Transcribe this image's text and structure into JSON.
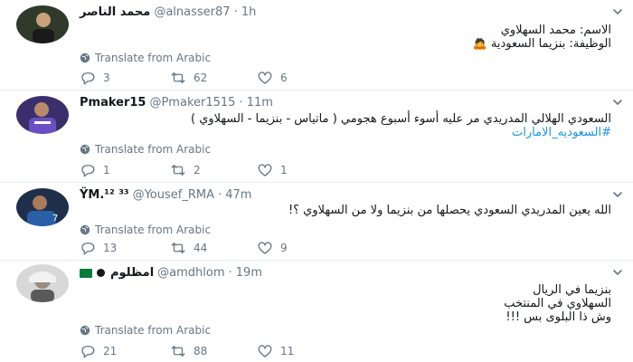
{
  "translate_label": "Translate from Arabic",
  "colors": {
    "accent": "#1b95e0",
    "muted": "#657786",
    "divider": "#e6ecf0"
  },
  "tweets": [
    {
      "name": "محمد الناصر",
      "handle": "@alnasser87",
      "time": "· 1h",
      "lines": [
        "الاسم: محمد السهلاوي",
        "الوظيفة: بنزيما السعودية 🙇"
      ],
      "replies": "3",
      "retweets": "62",
      "likes": "6"
    },
    {
      "name": "Pmaker15",
      "handle": "@Pmaker1515",
      "time": "· 11m",
      "lines": [
        "السعودي الهلالي المدريدي مر عليه أسوء أسبوع هجومي ( ماتياس - بنزيما - السهلاوي )"
      ],
      "hashtag": "#السعوديه_الامارات",
      "replies": "1",
      "retweets": "2",
      "likes": "1"
    },
    {
      "name": "ŸM.¹² ³³",
      "handle": "@Yousef_RMA",
      "time": "· 47m",
      "lines": [
        "الله يعين المدريدي السعودي يحصلها من بنزيما ولا من السهلاوي ؟!"
      ],
      "replies": "13",
      "retweets": "44",
      "likes": "9"
    },
    {
      "name": "امظلوم",
      "handle": "@amdhlom",
      "time": "· 19m",
      "lines": [
        "بنزيما في الريال",
        "السهلاوي في المنتخب",
        "وش ذا البلوى بس !!!"
      ],
      "replies": "21",
      "retweets": "88",
      "likes": "11"
    }
  ]
}
